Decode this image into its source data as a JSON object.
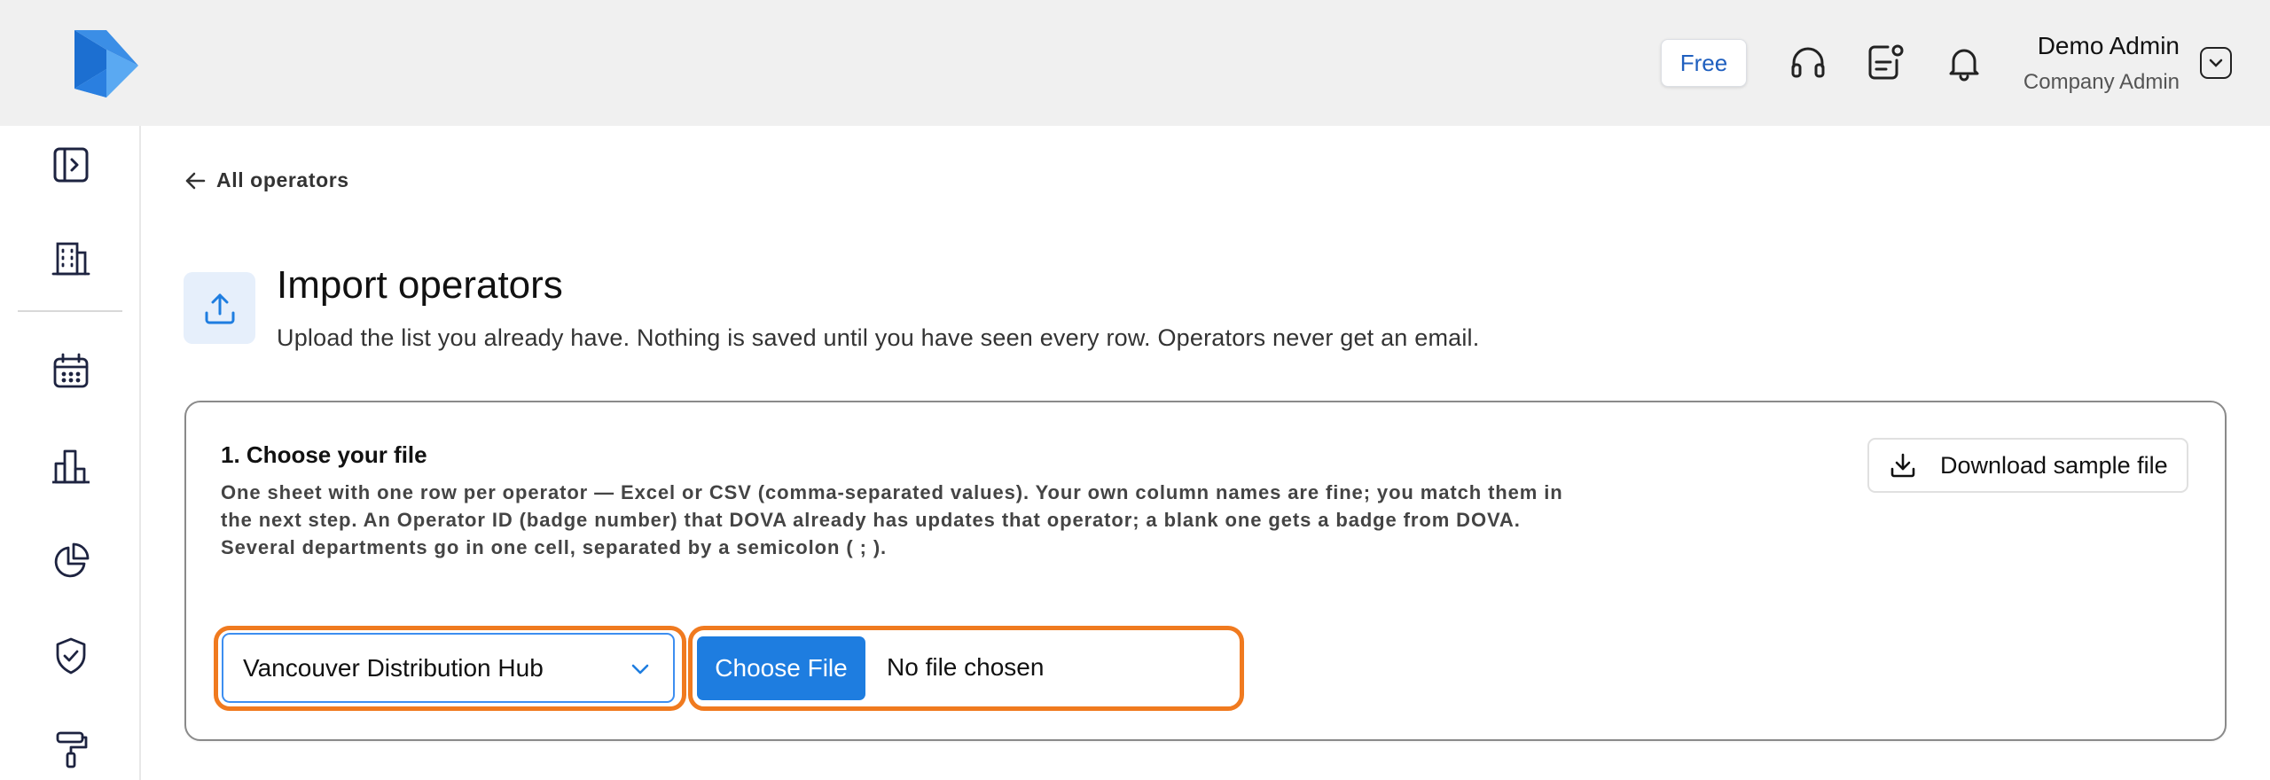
{
  "topbar": {
    "plan_label": "Free",
    "user_name": "Demo Admin",
    "user_role": "Company Admin"
  },
  "breadcrumb": {
    "back_label": "All operators"
  },
  "page": {
    "title": "Import operators",
    "subtitle": "Upload the list you already have. Nothing is saved until you have seen every row. Operators never get an email."
  },
  "step1": {
    "title": "1. Choose your file",
    "description": "One sheet with one row per operator — Excel or CSV (comma-separated values). Your own column names are fine; you match them in the next step. An Operator ID (badge number) that DOVA already has updates that operator; a blank one gets a badge from DOVA. Several departments go in one cell, separated by a semicolon ( ; ).",
    "download_label": "Download sample file",
    "site_selected": "Vancouver Distribution Hub",
    "choose_file_label": "Choose File",
    "file_status": "No file chosen"
  },
  "colors": {
    "accent": "#1e7de0",
    "highlight_ring": "#f07a1f",
    "topbar_bg": "#f0f0f0"
  },
  "icons": {
    "top": [
      "headset-icon",
      "notes-icon",
      "bell-icon",
      "chevron-down-icon"
    ],
    "sidebar": [
      "sidebar-toggle-icon",
      "building-icon",
      "calendar-icon",
      "bar-chart-icon",
      "pie-chart-icon",
      "shield-check-icon",
      "paint-roller-icon"
    ]
  }
}
